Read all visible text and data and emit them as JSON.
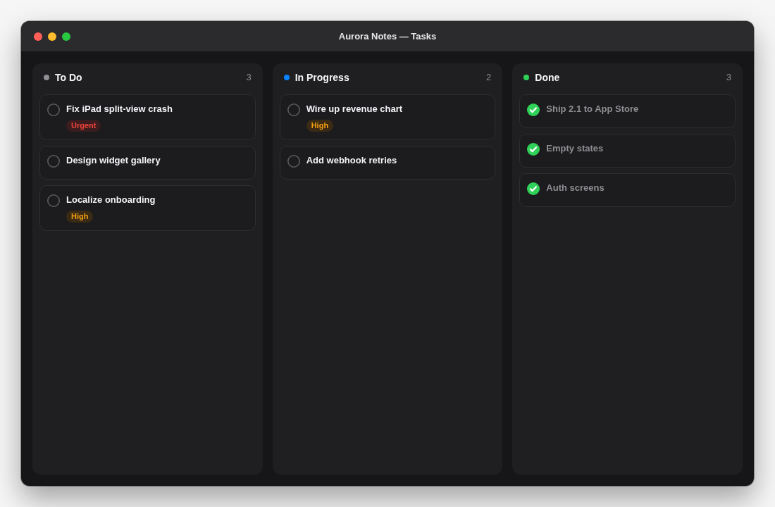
{
  "window": {
    "title": "Aurora Notes — Tasks"
  },
  "columns": [
    {
      "title": "To Do",
      "count": "3",
      "color": "#8e8e93",
      "tasks": [
        {
          "title": "Fix iPad split-view crash",
          "done": false,
          "tag": {
            "label": "Urgent",
            "kind": "urgent"
          }
        },
        {
          "title": "Design widget gallery",
          "done": false
        },
        {
          "title": "Localize onboarding",
          "done": false,
          "tag": {
            "label": "High",
            "kind": "high"
          }
        }
      ]
    },
    {
      "title": "In Progress",
      "count": "2",
      "color": "#0a84ff",
      "tasks": [
        {
          "title": "Wire up revenue chart",
          "done": false,
          "tag": {
            "label": "High",
            "kind": "high"
          }
        },
        {
          "title": "Add webhook retries",
          "done": false
        }
      ]
    },
    {
      "title": "Done",
      "count": "3",
      "color": "#30d158",
      "tasks": [
        {
          "title": "Ship 2.1 to App Store",
          "done": true
        },
        {
          "title": "Empty states",
          "done": true
        },
        {
          "title": "Auth screens",
          "done": true
        }
      ]
    }
  ]
}
